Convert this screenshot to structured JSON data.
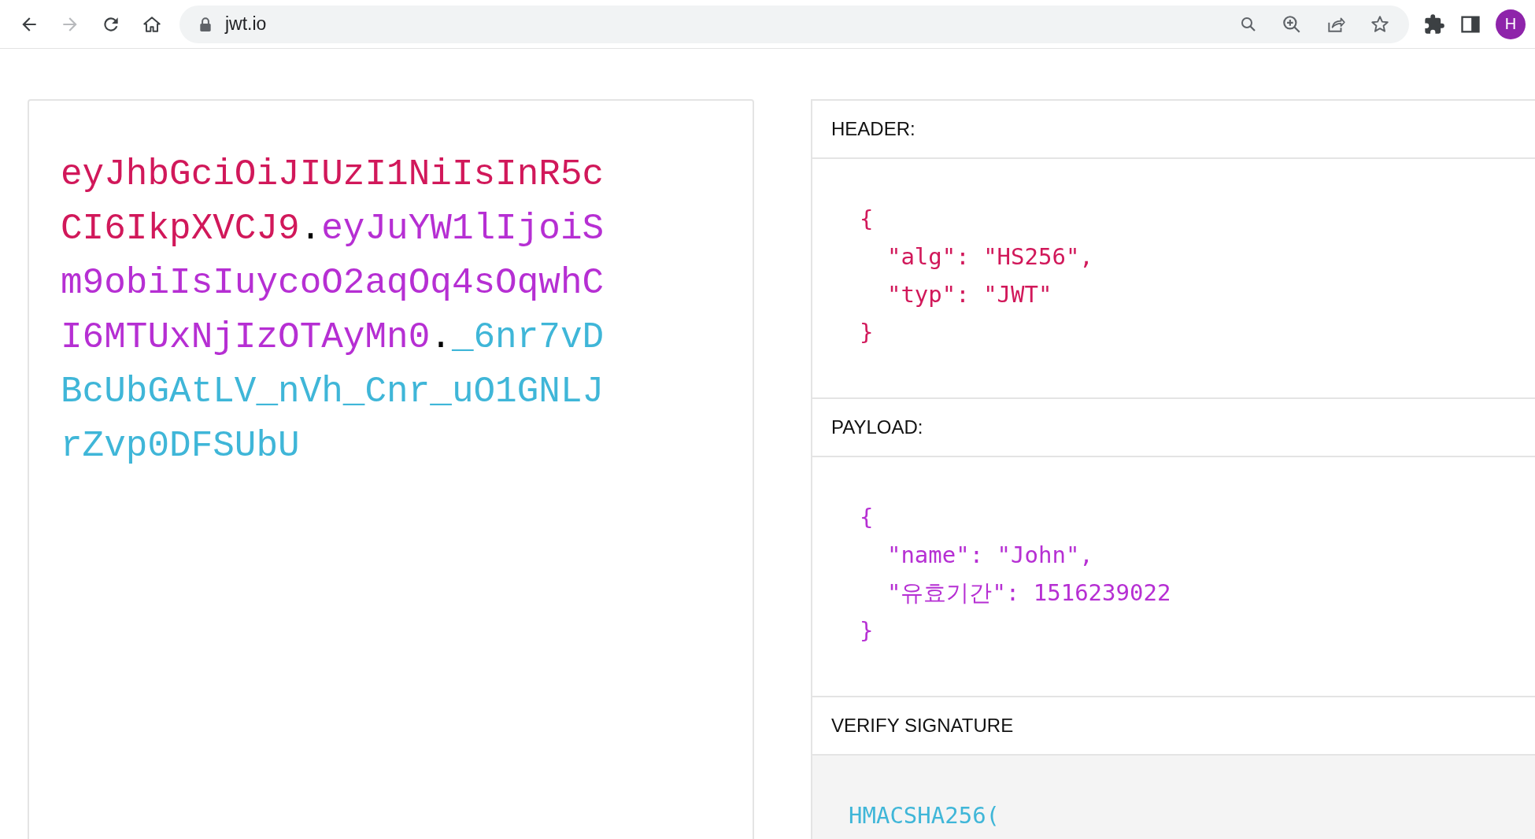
{
  "browser": {
    "nav_buttons": [
      {
        "kind": "back",
        "disabled": false
      },
      {
        "kind": "forward",
        "disabled": true
      },
      {
        "kind": "reload",
        "disabled": false
      },
      {
        "kind": "home",
        "disabled": false
      }
    ],
    "address": "jwt.io",
    "profile_initial": "H"
  },
  "encoded": {
    "segments": [
      {
        "kind": "header",
        "text": "eyJhbGciOiJIUzI1NiIsInR5cCI6IkpXVCJ9"
      },
      {
        "kind": "dot",
        "text": "."
      },
      {
        "kind": "payload",
        "text": "eyJuYW1lIjoiSm9obiIsIuycoO2aqOq4sOqwhCI6MTUxNjIzOTAyMn0"
      },
      {
        "kind": "dot",
        "text": "."
      },
      {
        "kind": "signature",
        "text": "_6nr7vDBcUbGAtLV_nVh_Cnr_uO1GNLJrZvp0DFSUbU"
      }
    ]
  },
  "decoded": {
    "sections": [
      {
        "title": "HEADER:",
        "kind": "header",
        "lines": [
          "{",
          "  \"alg\": \"HS256\",",
          "  \"typ\": \"JWT\"",
          "}"
        ]
      },
      {
        "title": "PAYLOAD:",
        "kind": "payload",
        "lines": [
          "{",
          "  \"name\": \"John\",",
          "  \"유효기간\": 1516239022",
          "}"
        ]
      },
      {
        "title": "VERIFY SIGNATURE",
        "kind": "signature",
        "lines": [
          "HMACSHA256("
        ]
      }
    ]
  }
}
